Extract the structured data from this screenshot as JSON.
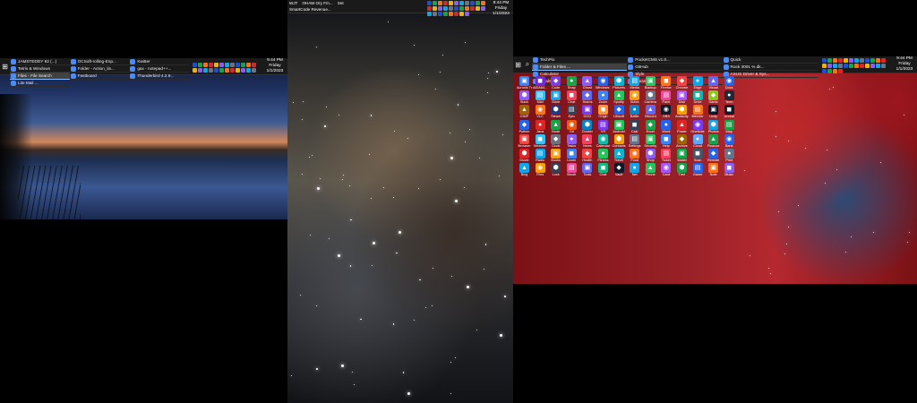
{
  "monitors": {
    "left": {
      "taskbar": {
        "items": [
          {
            "label": "JAMSTEDDY 92 (...)",
            "active": false
          },
          {
            "label": "OCSoft-rolling-Enp...",
            "active": false
          },
          {
            "label": "Kwitter",
            "active": false
          },
          {
            "label": "Tetris & Windows",
            "active": false
          },
          {
            "label": "Folder - Action_lis...",
            "active": false
          },
          {
            "label": "gax - notepad++...",
            "active": false
          },
          {
            "label": "Files - File Search",
            "active": true
          },
          {
            "label": "Fastboard",
            "active": false
          },
          {
            "label": "Thunderbird 4.2.9...",
            "active": false
          },
          {
            "label": "Lite Mail ...",
            "active": false
          }
        ],
        "clock": {
          "time": "9:44 PM",
          "day": "Friday",
          "date": "1/1/2023"
        }
      }
    },
    "middle": {
      "taskbar": {
        "row1": [
          "WJT",
          "OHAM Ory Fm...",
          "Set"
        ],
        "row2": [
          "SmartCode Revenue..."
        ],
        "clock": {
          "time": "9:44 PM",
          "day": "Friday",
          "date": "1/1/2023"
        }
      }
    },
    "right": {
      "taskbar": {
        "items": [
          {
            "label": "TechPix",
            "active": false
          },
          {
            "label": "PocketCMS v1.0...",
            "active": false
          },
          {
            "label": "Quick",
            "active": false
          },
          {
            "label": "Folder & Files ...",
            "active": true
          },
          {
            "label": "GitHub",
            "active": false
          },
          {
            "label": "Rock 3001 % dk...",
            "active": false
          },
          {
            "label": "Calculator",
            "active": false
          },
          {
            "label": "Slyle",
            "active": false
          },
          {
            "label": "ASUS Driver & Sys...",
            "active": false
          },
          {
            "label": "GoalShell",
            "active": false
          },
          {
            "label": "Steam",
            "active": false
          }
        ],
        "clock": {
          "time": "9:44 PM",
          "day": "Friday",
          "date": "1/1/2023"
        }
      },
      "desktop_icons": [
        {
          "label": "Acronis True...",
          "icon": "disc-icon",
          "color": "#3b82f6"
        },
        {
          "label": "AIDA64...",
          "icon": "app-icon",
          "color": "#6d28d9"
        },
        {
          "label": "Code",
          "icon": "code-icon",
          "color": "#7c3aed"
        },
        {
          "label": "Snap",
          "icon": "snap-icon",
          "color": "#16a34a"
        },
        {
          "label": "Ghost",
          "icon": "ghost-icon",
          "color": "#8b5cf6"
        },
        {
          "label": "Windows 10",
          "icon": "windows-icon",
          "color": "#2563eb"
        },
        {
          "label": "Pictures",
          "icon": "photo-icon",
          "color": "#06b6d4"
        },
        {
          "label": "Media",
          "icon": "media-icon",
          "color": "#0ea5e9"
        },
        {
          "label": "Backup",
          "icon": "backup-icon",
          "color": "#22c55e"
        },
        {
          "label": "Firefox",
          "icon": "firefox-icon",
          "color": "#f97316"
        },
        {
          "label": "Chrome",
          "icon": "chrome-icon",
          "color": "#ef4444"
        },
        {
          "label": "Edge",
          "icon": "edge-icon",
          "color": "#0ea5e9"
        },
        {
          "label": "Visual",
          "icon": "visual-icon",
          "color": "#6366f1"
        },
        {
          "label": "Docs",
          "icon": "docs-icon",
          "color": "#2563eb"
        },
        {
          "label": "Slack",
          "icon": "slack-icon",
          "color": "#8b5cf6"
        },
        {
          "label": "Mail",
          "icon": "mail-icon",
          "color": "#38bdf8"
        },
        {
          "label": "Store",
          "icon": "store-icon",
          "color": "#0ea5e9"
        },
        {
          "label": "Chat",
          "icon": "chat-icon",
          "color": "#f43f5e"
        },
        {
          "label": "Teams",
          "icon": "teams-icon",
          "color": "#6366f1"
        },
        {
          "label": "Zoom",
          "icon": "zoom-icon",
          "color": "#3b82f6"
        },
        {
          "label": "Spotify",
          "icon": "music-icon",
          "color": "#22c55e"
        },
        {
          "label": "Notes",
          "icon": "notes-icon",
          "color": "#f59e0b"
        },
        {
          "label": "Camera",
          "icon": "camera-icon",
          "color": "#64748b"
        },
        {
          "label": "Paint",
          "icon": "paint-icon",
          "color": "#ec4899"
        },
        {
          "label": "Disk",
          "icon": "disk-icon",
          "color": "#a855f7"
        },
        {
          "label": "Drive",
          "icon": "drive-icon",
          "color": "#14b8a6"
        },
        {
          "label": "Game",
          "icon": "game-icon",
          "color": "#84cc16"
        },
        {
          "label": "Term",
          "icon": "terminal-icon",
          "color": "#1f2937"
        },
        {
          "label": "GIMP",
          "icon": "gimp-icon",
          "color": "#a16207"
        },
        {
          "label": "VLC",
          "icon": "vlc-icon",
          "color": "#f97316"
        },
        {
          "label": "Steam",
          "icon": "steam-icon",
          "color": "#1e3a8a"
        },
        {
          "label": "Epic",
          "icon": "epic-icon",
          "color": "#334155"
        },
        {
          "label": "GOG",
          "icon": "gog-icon",
          "color": "#7c3aed"
        },
        {
          "label": "Origin",
          "icon": "origin-icon",
          "color": "#fb923c"
        },
        {
          "label": "Ubisoft",
          "icon": "ubisoft-icon",
          "color": "#2563eb"
        },
        {
          "label": "Battle",
          "icon": "battle-icon",
          "color": "#0284c7"
        },
        {
          "label": "Discord",
          "icon": "discord-icon",
          "color": "#6366f1"
        },
        {
          "label": "OBS",
          "icon": "obs-icon",
          "color": "#111827"
        },
        {
          "label": "Audacity",
          "icon": "audio-icon",
          "color": "#f59e0b"
        },
        {
          "label": "Blender",
          "icon": "blender-icon",
          "color": "#f97316"
        },
        {
          "label": "Unity",
          "icon": "unity-icon",
          "color": "#0f172a"
        },
        {
          "label": "Unreal",
          "icon": "unreal-icon",
          "color": "#111827"
        },
        {
          "label": "Python",
          "icon": "python-icon",
          "color": "#2563eb"
        },
        {
          "label": "Java",
          "icon": "java-icon",
          "color": "#dc2626"
        },
        {
          "label": "Node",
          "icon": "node-icon",
          "color": "#16a34a"
        },
        {
          "label": "Git",
          "icon": "git-icon",
          "color": "#ea580c"
        },
        {
          "label": "Docker",
          "icon": "docker-icon",
          "color": "#0284c7"
        },
        {
          "label": "VS",
          "icon": "vs-icon",
          "color": "#7c3aed"
        },
        {
          "label": "Android",
          "icon": "android-icon",
          "color": "#22c55e"
        },
        {
          "label": "Calc",
          "icon": "calc-icon",
          "color": "#334155"
        },
        {
          "label": "Excel",
          "icon": "excel-icon",
          "color": "#16a34a"
        },
        {
          "label": "Word",
          "icon": "word-icon",
          "color": "#2563eb"
        },
        {
          "label": "Power",
          "icon": "power-icon",
          "color": "#dc2626"
        },
        {
          "label": "OneNote",
          "icon": "onenote-icon",
          "color": "#7c3aed"
        },
        {
          "label": "Photos",
          "icon": "photo-icon",
          "color": "#0ea5e9"
        },
        {
          "label": "Map",
          "icon": "map-icon",
          "color": "#16a34a"
        },
        {
          "label": "Browser",
          "icon": "browser-icon",
          "color": "#ef4444"
        },
        {
          "label": "Weather",
          "icon": "weather-icon",
          "color": "#38bdf8"
        },
        {
          "label": "Clock",
          "icon": "clock-icon",
          "color": "#6b7280"
        },
        {
          "label": "Tasks",
          "icon": "tasks-icon",
          "color": "#8b5cf6"
        },
        {
          "label": "News",
          "icon": "news-icon",
          "color": "#f43f5e"
        },
        {
          "label": "Calendar",
          "icon": "calendar-icon",
          "color": "#14b8a6"
        },
        {
          "label": "Contacts",
          "icon": "contacts-icon",
          "color": "#f59e0b"
        },
        {
          "label": "Settings",
          "icon": "gear-icon",
          "color": "#64748b"
        },
        {
          "label": "Security",
          "icon": "shield-icon",
          "color": "#22c55e"
        },
        {
          "label": "Help",
          "icon": "help-icon",
          "color": "#3b82f6"
        },
        {
          "label": "Archive",
          "icon": "archive-icon",
          "color": "#a16207"
        },
        {
          "label": "Cloud",
          "icon": "cloud-icon",
          "color": "#60a5fa"
        },
        {
          "label": "Finance",
          "icon": "finance-icon",
          "color": "#16a34a"
        },
        {
          "label": "Bank",
          "icon": "bank-icon",
          "color": "#2563eb"
        },
        {
          "label": "Movie",
          "icon": "movie-icon",
          "color": "#dc2626"
        },
        {
          "label": "Radio",
          "icon": "radio-icon",
          "color": "#0ea5e9"
        },
        {
          "label": "Books",
          "icon": "books-icon",
          "color": "#f59e0b"
        },
        {
          "label": "Learn",
          "icon": "learn-icon",
          "color": "#3b82f6"
        },
        {
          "label": "Health",
          "icon": "health-icon",
          "color": "#ef4444"
        },
        {
          "label": "Fitness",
          "icon": "fitness-icon",
          "color": "#22c55e"
        },
        {
          "label": "Travel",
          "icon": "travel-icon",
          "color": "#06b6d4"
        },
        {
          "label": "Food",
          "icon": "food-icon",
          "color": "#f97316"
        },
        {
          "label": "Shop",
          "icon": "shop-icon",
          "color": "#8b5cf6"
        },
        {
          "label": "Ticket",
          "icon": "ticket-icon",
          "color": "#f43f5e"
        },
        {
          "label": "Wallet",
          "icon": "wallet-icon",
          "color": "#16a34a"
        },
        {
          "label": "Scan",
          "icon": "scan-icon",
          "color": "#475569"
        },
        {
          "label": "Remote",
          "icon": "remote-icon",
          "color": "#2563eb"
        },
        {
          "label": "Print",
          "icon": "print-icon",
          "color": "#64748b"
        },
        {
          "label": "Bing",
          "icon": "bing-icon",
          "color": "#0ea5e9"
        },
        {
          "label": "Files",
          "icon": "files-icon",
          "color": "#f59e0b"
        },
        {
          "label": "Lock",
          "icon": "lock-icon",
          "color": "#374151"
        },
        {
          "label": "Brush",
          "icon": "brush-icon",
          "color": "#ec4899"
        },
        {
          "label": "Tools",
          "icon": "tools-icon",
          "color": "#6366f1"
        },
        {
          "label": "Chat",
          "icon": "chat-icon",
          "color": "#10b981"
        },
        {
          "label": "Vault",
          "icon": "vault-icon",
          "color": "#111827"
        },
        {
          "label": "Net",
          "icon": "network-icon",
          "color": "#0ea5e9"
        },
        {
          "label": "Phone",
          "icon": "phone-icon",
          "color": "#22c55e"
        },
        {
          "label": "Card",
          "icon": "card-icon",
          "color": "#a855f7"
        },
        {
          "label": "Tree",
          "icon": "tree-icon",
          "color": "#16a34a"
        },
        {
          "label": "Game",
          "icon": "game-icon",
          "color": "#2563eb"
        },
        {
          "label": "Note",
          "icon": "notes-icon",
          "color": "#f97316"
        },
        {
          "label": "Music",
          "icon": "music-icon",
          "color": "#8b5cf6"
        }
      ]
    }
  }
}
